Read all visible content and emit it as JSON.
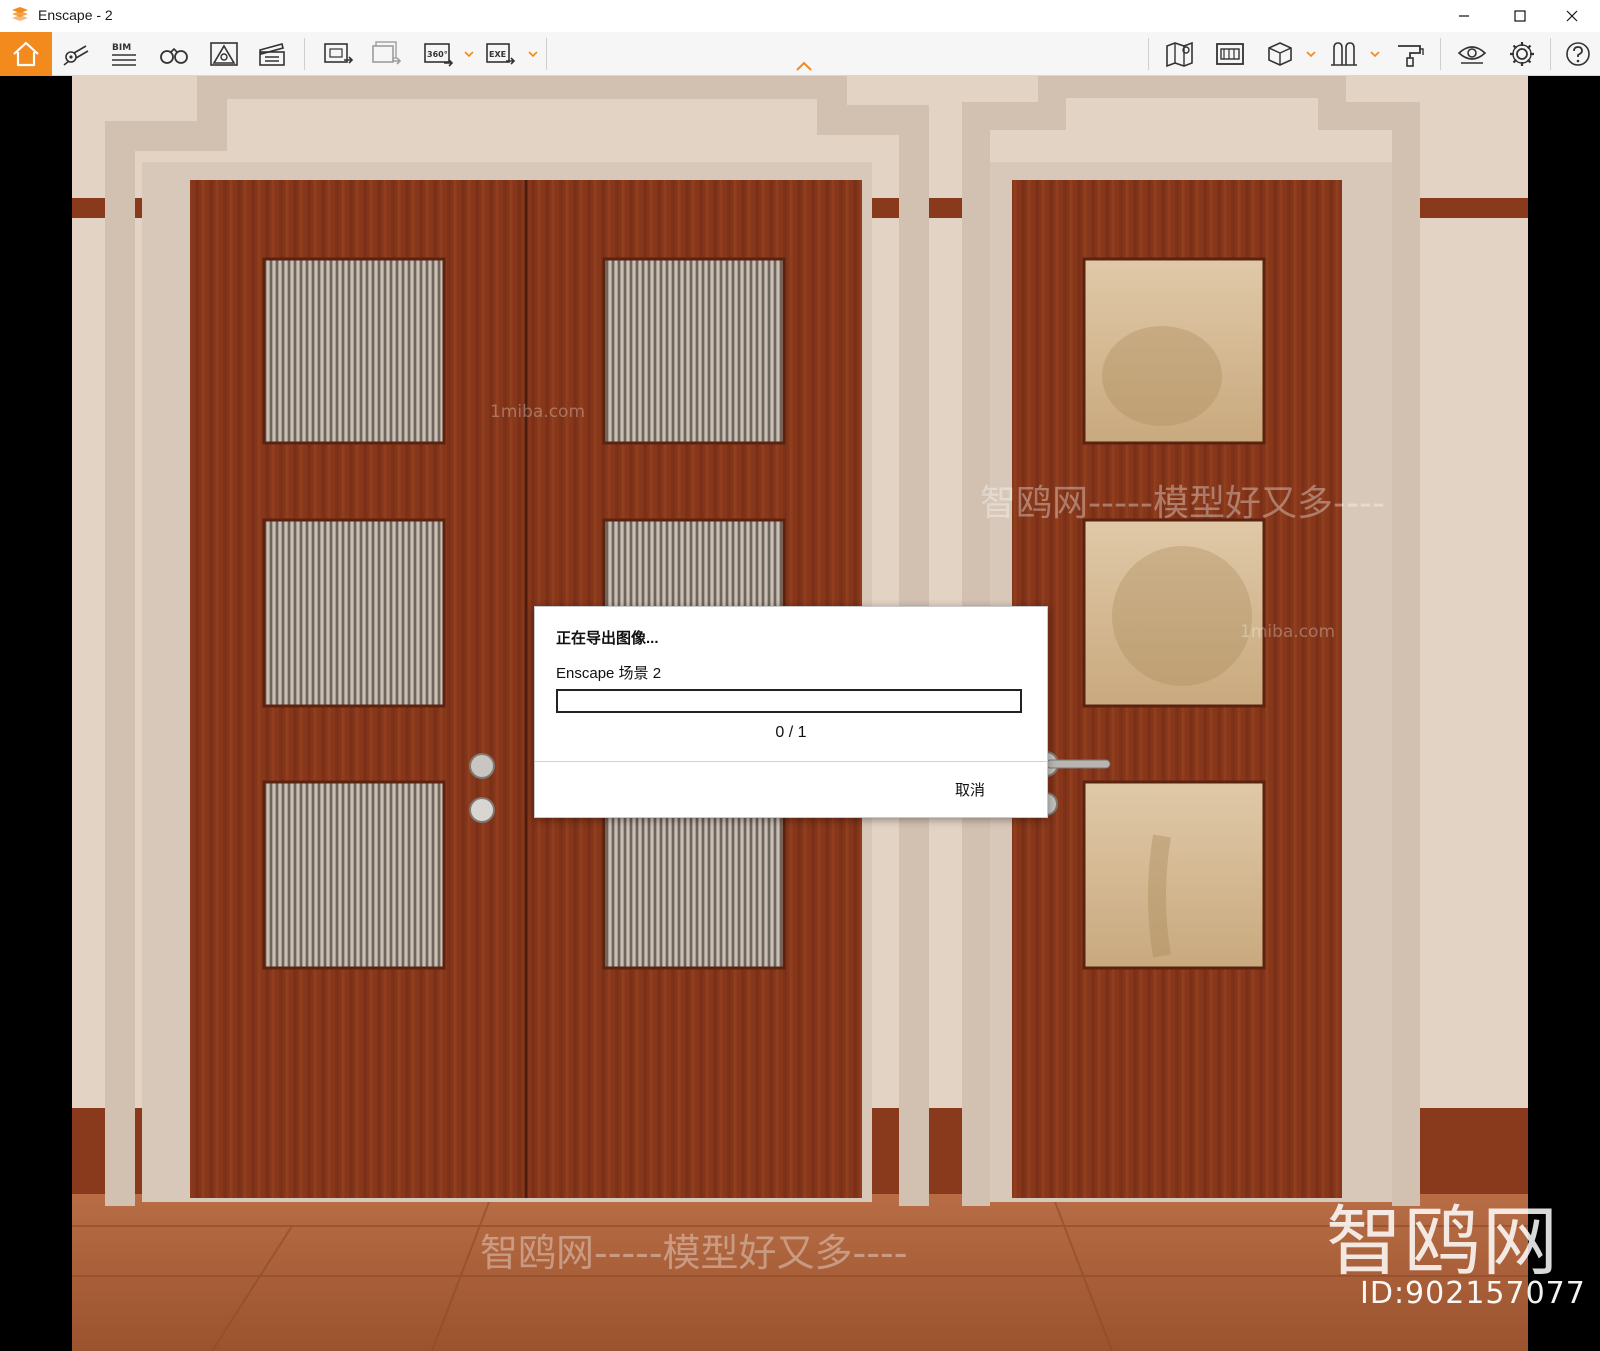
{
  "window": {
    "title": "Enscape - 2"
  },
  "toolbar": {
    "left_icons": [
      "home-icon",
      "views-icon",
      "bim-icon",
      "binoculars-icon",
      "visual-settings-icon",
      "video-editor-icon",
      "render-image-icon",
      "batch-render-icon",
      "panorama-360-icon",
      "export-exe-icon"
    ],
    "bim_label": "BIM",
    "panorama_label": "360°",
    "exe_label": "EXE",
    "right_icons": [
      "map-icon",
      "image-gallery-icon",
      "cube-icon",
      "asset-library-icon",
      "material-editor-icon",
      "visibility-icon",
      "settings-icon",
      "help-icon"
    ],
    "accent_color": "#f28a1e"
  },
  "dialog": {
    "title": "正在导出图像...",
    "item": "Enscape 场景 2",
    "progress_fraction": 0,
    "progress_text": "0 / 1",
    "cancel_label": "取消"
  },
  "watermark": {
    "logo_text": "智鸥网",
    "id_text": "ID:902157077",
    "tagline": "智鸥网-----模型好又多----",
    "site": "1miba.com"
  }
}
